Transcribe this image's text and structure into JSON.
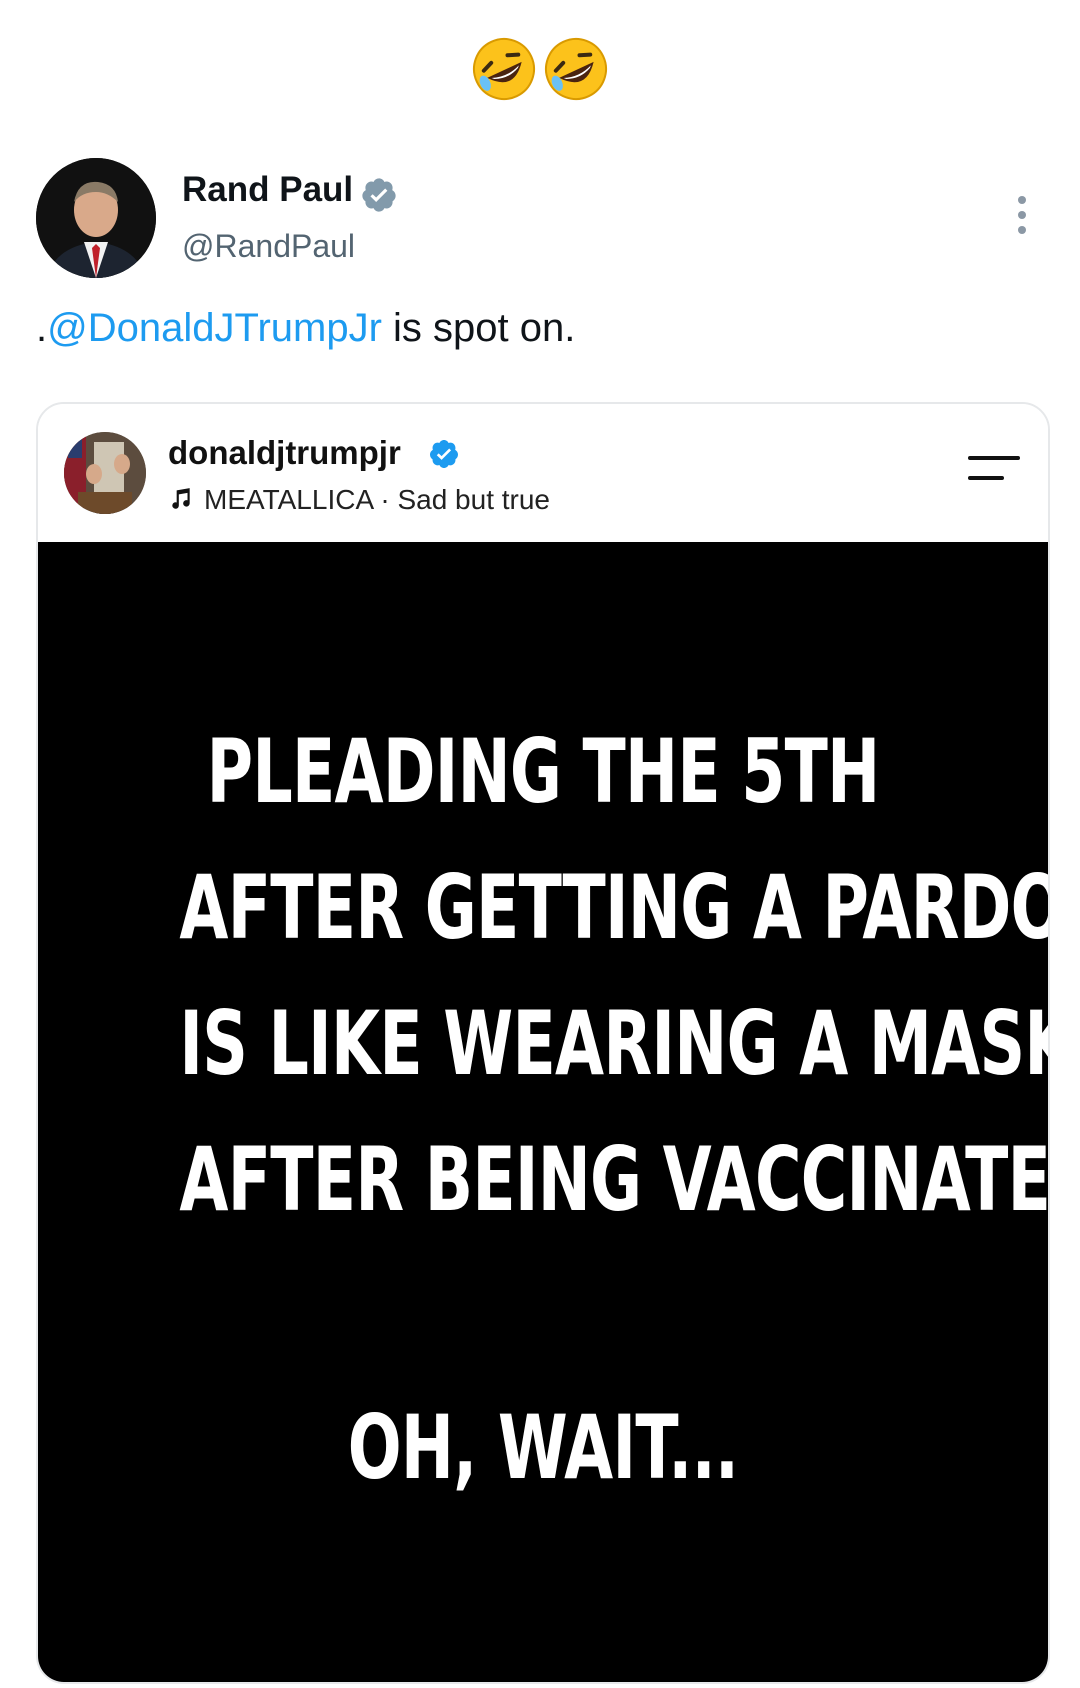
{
  "reaction": {
    "emoji": "🤣🤣",
    "icon": "rolling-on-floor-laughing-icon"
  },
  "author": {
    "name": "Rand Paul",
    "handle": "@RandPaul",
    "verified": true,
    "verified_color": "#829aab"
  },
  "tweet": {
    "prefix": ".",
    "mention": "@DonaldJTrumpJr",
    "rest": " is spot on.",
    "mention_color": "#1d9bf0"
  },
  "embed": {
    "username": "donaldjtrumpjr",
    "verified": true,
    "verified_color": "#1d9bf0",
    "music": "MEATALLICA · Sad but true",
    "meme_lines": [
      "PLEADING THE 5TH",
      "AFTER GETTING A PARDON",
      "IS LIKE WEARING A MASK",
      "AFTER BEING VACCINATED."
    ],
    "meme_punchline": "OH, WAIT..."
  }
}
